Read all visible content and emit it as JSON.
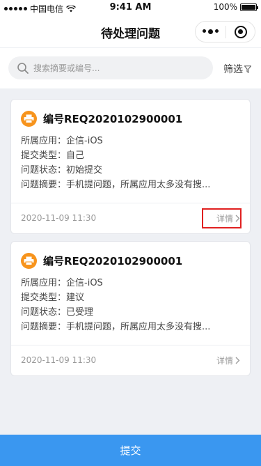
{
  "status_bar": {
    "carrier": "中国电信",
    "time": "9:41 AM",
    "battery": "100%"
  },
  "nav": {
    "title": "待处理问题"
  },
  "search": {
    "placeholder": "搜索摘要或编号...",
    "filter_label": "筛选"
  },
  "labels": {
    "app": "所属应用：",
    "type": "提交类型：",
    "state": "问题状态：",
    "summary": "问题摘要：",
    "detail": "详情"
  },
  "cards": [
    {
      "number": "编号REQ2020102900001",
      "app": "企信-iOS",
      "type": "自己",
      "state": "初始提交",
      "summary": "手机提问题，所属应用太多没有搜...",
      "date": "2020-11-09  11:30"
    },
    {
      "number": "编号REQ2020102900001",
      "app": "企信-iOS",
      "type": "建议",
      "state": "已受理",
      "summary": "手机提问题，所属应用太多没有搜...",
      "date": "2020-11-09  11:30"
    }
  ],
  "footer": {
    "submit_label": "提交"
  },
  "colors": {
    "accent": "#3a97f0",
    "icon_orange": "#f7941d",
    "highlight": "#e02020"
  }
}
